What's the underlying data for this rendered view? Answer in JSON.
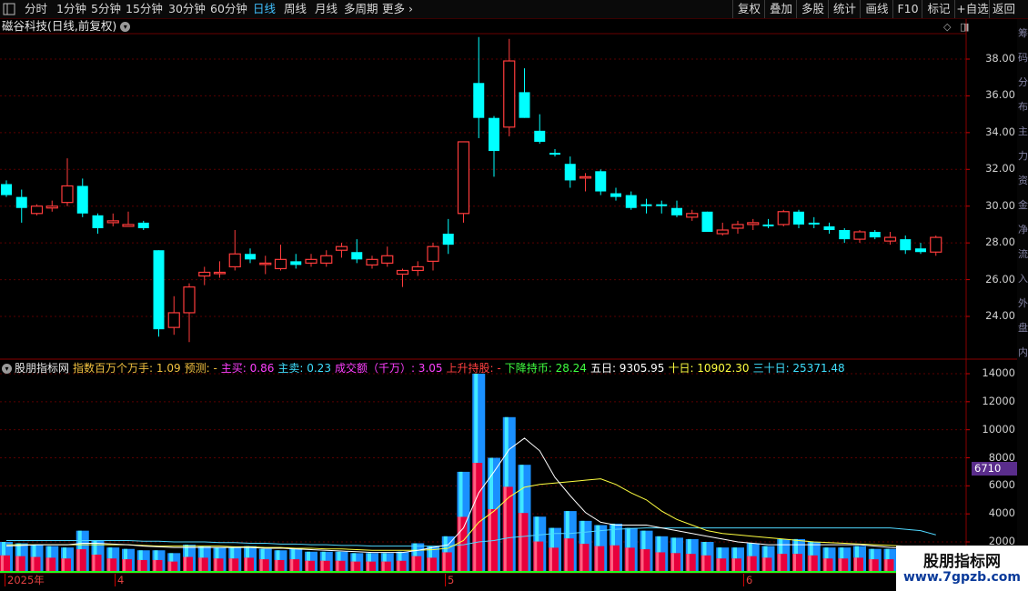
{
  "toolbar": {
    "left_items": [
      "分时",
      "1分钟",
      "5分钟",
      "15分钟",
      "30分钟",
      "60分钟",
      "日线",
      "周线",
      "月线",
      "多周期",
      "更多"
    ],
    "active": "日线",
    "right_items": [
      "复权",
      "叠加",
      "多股",
      "统计",
      "画线",
      "F10",
      "标记",
      "+自选",
      "返回"
    ]
  },
  "main_chart": {
    "title": "磁谷科技(日线,前复权)",
    "y_ticks": [
      "38.00",
      "36.00",
      "34.00",
      "32.00",
      "30.00",
      "28.00",
      "26.00",
      "24.00"
    ],
    "candles": [
      {
        "o": 31.2,
        "c": 30.6,
        "h": 31.4,
        "l": 30.5
      },
      {
        "o": 30.5,
        "c": 29.9,
        "h": 30.9,
        "l": 29.1
      },
      {
        "o": 29.6,
        "c": 30.0,
        "h": 30.1,
        "l": 29.5
      },
      {
        "o": 29.9,
        "c": 30.0,
        "h": 30.3,
        "l": 29.7
      },
      {
        "o": 30.2,
        "c": 31.1,
        "h": 32.6,
        "l": 30.0
      },
      {
        "o": 31.1,
        "c": 29.6,
        "h": 31.5,
        "l": 29.4
      },
      {
        "o": 29.5,
        "c": 28.8,
        "h": 29.6,
        "l": 28.5
      },
      {
        "o": 29.1,
        "c": 29.2,
        "h": 29.6,
        "l": 28.9
      },
      {
        "o": 28.9,
        "c": 29.0,
        "h": 29.7,
        "l": 28.9
      },
      {
        "o": 29.1,
        "c": 28.8,
        "h": 29.2,
        "l": 28.7
      },
      {
        "o": 27.6,
        "c": 23.3,
        "h": 27.6,
        "l": 22.9
      },
      {
        "o": 23.4,
        "c": 24.2,
        "h": 25.1,
        "l": 23.0
      },
      {
        "o": 24.2,
        "c": 25.6,
        "h": 25.8,
        "l": 22.6
      },
      {
        "o": 26.2,
        "c": 26.4,
        "h": 26.7,
        "l": 25.7
      },
      {
        "o": 26.4,
        "c": 26.4,
        "h": 27.0,
        "l": 26.1
      },
      {
        "o": 26.7,
        "c": 27.4,
        "h": 28.7,
        "l": 26.5
      },
      {
        "o": 27.4,
        "c": 27.1,
        "h": 27.7,
        "l": 26.9
      },
      {
        "o": 26.9,
        "c": 26.9,
        "h": 27.3,
        "l": 26.3
      },
      {
        "o": 26.6,
        "c": 27.1,
        "h": 27.9,
        "l": 26.5
      },
      {
        "o": 27.0,
        "c": 26.8,
        "h": 27.4,
        "l": 26.6
      },
      {
        "o": 26.9,
        "c": 27.1,
        "h": 27.4,
        "l": 26.7
      },
      {
        "o": 26.9,
        "c": 27.3,
        "h": 27.6,
        "l": 26.7
      },
      {
        "o": 27.6,
        "c": 27.8,
        "h": 28.0,
        "l": 27.2
      },
      {
        "o": 27.5,
        "c": 27.1,
        "h": 28.2,
        "l": 26.9
      },
      {
        "o": 26.8,
        "c": 27.1,
        "h": 27.3,
        "l": 26.6
      },
      {
        "o": 26.9,
        "c": 27.3,
        "h": 27.8,
        "l": 26.7
      },
      {
        "o": 26.3,
        "c": 26.5,
        "h": 26.6,
        "l": 25.6
      },
      {
        "o": 26.5,
        "c": 26.7,
        "h": 27.0,
        "l": 26.2
      },
      {
        "o": 27.0,
        "c": 27.8,
        "h": 28.0,
        "l": 26.5
      },
      {
        "o": 28.5,
        "c": 27.9,
        "h": 29.3,
        "l": 27.4
      },
      {
        "o": 29.6,
        "c": 33.5,
        "h": 33.5,
        "l": 29.1
      },
      {
        "o": 36.7,
        "c": 34.8,
        "h": 39.2,
        "l": 33.7
      },
      {
        "o": 34.8,
        "c": 33.0,
        "h": 34.9,
        "l": 31.6
      },
      {
        "o": 34.3,
        "c": 37.9,
        "h": 39.1,
        "l": 33.8
      },
      {
        "o": 36.2,
        "c": 34.8,
        "h": 37.5,
        "l": 34.8
      },
      {
        "o": 34.1,
        "c": 33.5,
        "h": 35.0,
        "l": 33.4
      },
      {
        "o": 32.9,
        "c": 32.8,
        "h": 33.1,
        "l": 32.7
      },
      {
        "o": 32.3,
        "c": 31.4,
        "h": 32.7,
        "l": 31.0
      },
      {
        "o": 31.6,
        "c": 31.6,
        "h": 31.8,
        "l": 30.8
      },
      {
        "o": 31.9,
        "c": 30.8,
        "h": 32.0,
        "l": 30.6
      },
      {
        "o": 30.7,
        "c": 30.5,
        "h": 31.0,
        "l": 30.3
      },
      {
        "o": 30.6,
        "c": 29.9,
        "h": 30.8,
        "l": 29.8
      },
      {
        "o": 30.1,
        "c": 30.0,
        "h": 30.4,
        "l": 29.6
      },
      {
        "o": 30.1,
        "c": 30.0,
        "h": 30.3,
        "l": 29.6
      },
      {
        "o": 29.9,
        "c": 29.5,
        "h": 30.3,
        "l": 29.4
      },
      {
        "o": 29.4,
        "c": 29.6,
        "h": 29.8,
        "l": 29.2
      },
      {
        "o": 29.7,
        "c": 28.6,
        "h": 29.7,
        "l": 28.6
      },
      {
        "o": 28.5,
        "c": 28.7,
        "h": 29.1,
        "l": 28.4
      },
      {
        "o": 28.8,
        "c": 29.0,
        "h": 29.2,
        "l": 28.5
      },
      {
        "o": 29.0,
        "c": 29.1,
        "h": 29.3,
        "l": 28.7
      },
      {
        "o": 29.0,
        "c": 28.9,
        "h": 29.3,
        "l": 28.8
      },
      {
        "o": 29.0,
        "c": 29.7,
        "h": 29.8,
        "l": 28.9
      },
      {
        "o": 29.7,
        "c": 29.0,
        "h": 29.8,
        "l": 28.8
      },
      {
        "o": 29.1,
        "c": 29.0,
        "h": 29.4,
        "l": 28.8
      },
      {
        "o": 28.9,
        "c": 28.7,
        "h": 29.1,
        "l": 28.5
      },
      {
        "o": 28.7,
        "c": 28.2,
        "h": 28.8,
        "l": 28.0
      },
      {
        "o": 28.2,
        "c": 28.6,
        "h": 28.7,
        "l": 28.0
      },
      {
        "o": 28.6,
        "c": 28.3,
        "h": 28.7,
        "l": 28.2
      },
      {
        "o": 28.1,
        "c": 28.3,
        "h": 28.6,
        "l": 27.9
      },
      {
        "o": 28.2,
        "c": 27.6,
        "h": 28.4,
        "l": 27.4
      },
      {
        "o": 27.7,
        "c": 27.5,
        "h": 28.0,
        "l": 27.4
      },
      {
        "o": 27.5,
        "c": 28.3,
        "h": 28.4,
        "l": 27.3
      }
    ]
  },
  "indicator": {
    "name": "股朋指标网",
    "labels": [
      {
        "text": "指数百万个万手: 1.09",
        "color": "#f0c040"
      },
      {
        "text": "预测: -",
        "color": "#f0c040"
      },
      {
        "text": "主买: 0.86",
        "color": "#ff40ff"
      },
      {
        "text": "主卖: 0.23",
        "color": "#40e0ff"
      },
      {
        "text": "成交额（千万）: 3.05",
        "color": "#ff40ff"
      },
      {
        "text": "上升持股: -",
        "color": "#ff4040"
      },
      {
        "text": "下降持币: 28.24",
        "color": "#40ff40"
      },
      {
        "text": "五日: 9305.95",
        "color": "#ffffff"
      },
      {
        "text": "十日: 10902.30",
        "color": "#ffff40"
      },
      {
        "text": "三十日: 25371.48",
        "color": "#40e0ff"
      }
    ],
    "y_ticks": [
      "14000",
      "12000",
      "10000",
      "8000",
      "6000",
      "4000",
      "2000"
    ],
    "current_value": "6710",
    "volumes": [
      2000,
      1900,
      1800,
      1700,
      1600,
      2800,
      2100,
      1600,
      1500,
      1400,
      1400,
      1200,
      1800,
      1700,
      1600,
      1600,
      1700,
      1500,
      1400,
      1500,
      1300,
      1300,
      1300,
      1200,
      1200,
      1200,
      1300,
      1900,
      1700,
      2400,
      7000,
      14000,
      8000,
      10900,
      7500,
      3800,
      3000,
      4200,
      3500,
      3200,
      3300,
      3000,
      2800,
      2400,
      2300,
      2200,
      2000,
      1600,
      1600,
      1900,
      1700,
      2200,
      2200,
      2000,
      1600,
      1600,
      1700,
      1500,
      1500,
      1600,
      1500,
      1400
    ],
    "ma_white": [
      1700,
      1750,
      1800,
      1800,
      1800,
      1900,
      1900,
      1850,
      1800,
      1700,
      1650,
      1600,
      1600,
      1600,
      1600,
      1600,
      1600,
      1550,
      1550,
      1500,
      1450,
      1400,
      1350,
      1300,
      1250,
      1250,
      1250,
      1400,
      1600,
      1800,
      3000,
      5500,
      7000,
      8600,
      9400,
      8500,
      6600,
      5300,
      4100,
      3400,
      3200,
      3200,
      3200,
      3000,
      2800,
      2600,
      2400,
      2200,
      2000,
      1900,
      1800,
      1800,
      1800,
      1800,
      1800,
      1800,
      1800,
      1700,
      1600,
      1550,
      1500,
      1500
    ],
    "ma_yellow": [
      1800,
      1800,
      1800,
      1800,
      1800,
      1800,
      1800,
      1800,
      1800,
      1750,
      1700,
      1700,
      1700,
      1700,
      1700,
      1650,
      1650,
      1600,
      1600,
      1550,
      1550,
      1500,
      1500,
      1450,
      1400,
      1400,
      1400,
      1400,
      1450,
      1550,
      2100,
      3400,
      4200,
      5200,
      5900,
      6100,
      6200,
      6300,
      6400,
      6500,
      6100,
      5500,
      5000,
      4200,
      3600,
      3200,
      2800,
      2600,
      2500,
      2400,
      2300,
      2200,
      2100,
      2000,
      1950,
      1900,
      1850,
      1800,
      1750,
      1700,
      1650,
      1600
    ],
    "ma_cyan": [
      2100,
      2100,
      2100,
      2100,
      2100,
      2100,
      2100,
      2100,
      2100,
      2050,
      2050,
      2000,
      2000,
      2000,
      1950,
      1950,
      1900,
      1900,
      1850,
      1850,
      1800,
      1800,
      1750,
      1750,
      1700,
      1700,
      1700,
      1700,
      1700,
      1700,
      1800,
      2000,
      2100,
      2300,
      2400,
      2500,
      2600,
      2600,
      2700,
      2800,
      2900,
      2950,
      3000,
      3000,
      3000,
      3000,
      3000,
      3000,
      3000,
      3000,
      3000,
      3000,
      3000,
      3000,
      3000,
      3000,
      3000,
      3000,
      3000,
      2900,
      2800,
      2500
    ]
  },
  "x_axis": {
    "labels": [
      "2025年",
      "4",
      "5",
      "6"
    ]
  },
  "watermark": {
    "line1": "股朋指标网",
    "line2": "www.7gpzb.com"
  },
  "side_chars": [
    "筹",
    "码",
    "分",
    "布",
    "主",
    "力",
    "资",
    "金",
    "净",
    "流",
    "入",
    "外",
    "盘",
    "内"
  ],
  "colors": {
    "up": "#ff3c3c",
    "down": "#00ffff",
    "grid": "#5a0000"
  }
}
